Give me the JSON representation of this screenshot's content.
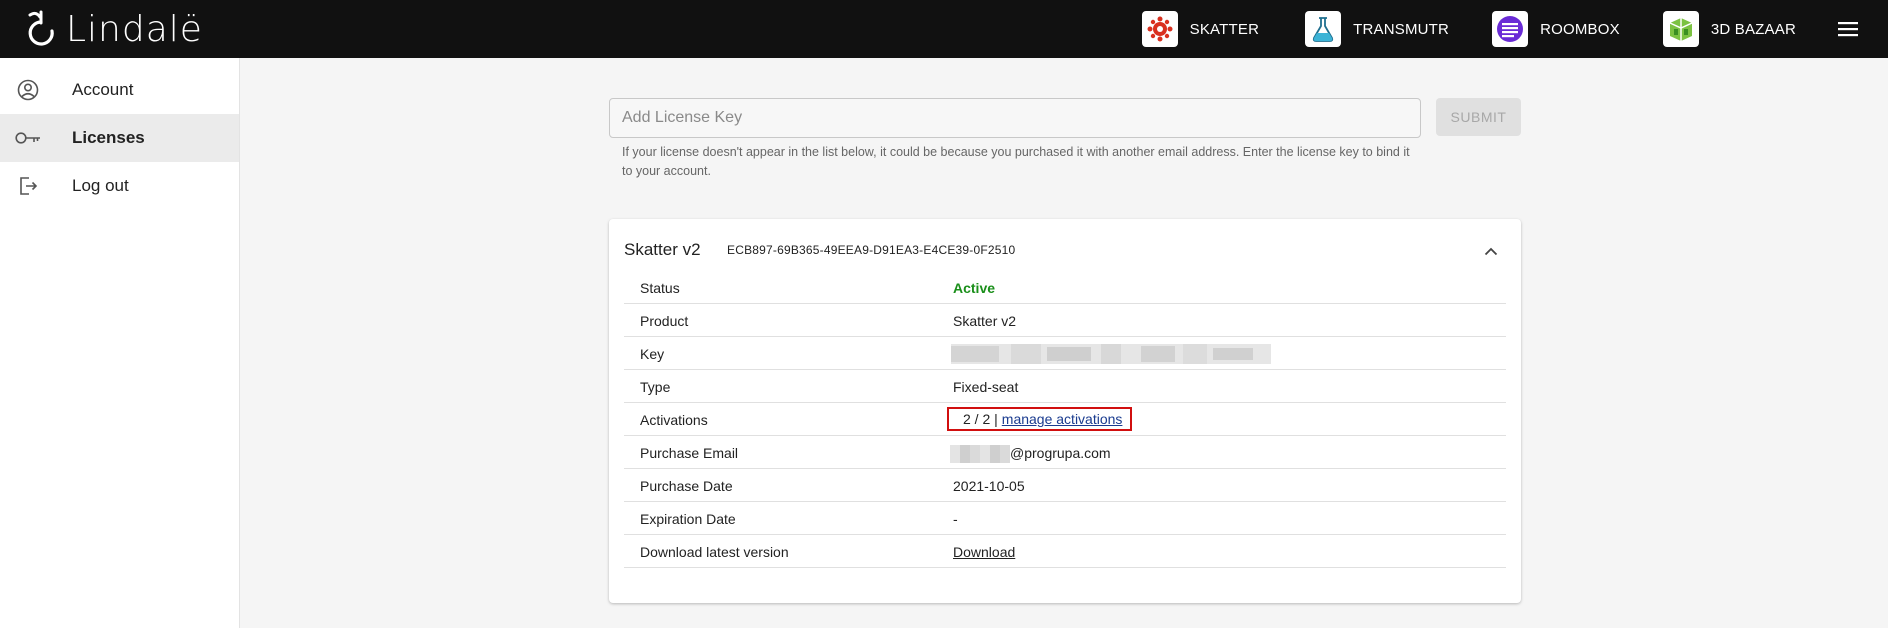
{
  "header": {
    "logo_text": "Lindalë",
    "apps": [
      {
        "label": "SKATTER",
        "icon": "skatter-icon"
      },
      {
        "label": "TRANSMUTR",
        "icon": "transmutr-icon"
      },
      {
        "label": "ROOMBOX",
        "icon": "roombox-icon"
      },
      {
        "label": "3D BAZAAR",
        "icon": "3d-bazaar-icon"
      }
    ],
    "menu_icon": "hamburger-menu-icon"
  },
  "sidebar": {
    "items": [
      {
        "label": "Account",
        "icon": "account-circle-icon",
        "active": false
      },
      {
        "label": "Licenses",
        "icon": "key-icon",
        "active": true
      },
      {
        "label": "Log out",
        "icon": "logout-icon",
        "active": false
      }
    ]
  },
  "license_form": {
    "placeholder": "Add License Key",
    "value": "",
    "submit_label": "SUBMIT",
    "help_text": "If your license doesn't appear in the list below, it could be because you purchased it with another email address. Enter the license key to bind it to your account."
  },
  "license_card": {
    "title": "Skatter v2",
    "key": "ECB897-69B365-49EEA9-D91EA3-E4CE39-0F2510",
    "expanded": true,
    "rows": {
      "status": {
        "label": "Status",
        "value": "Active"
      },
      "product": {
        "label": "Product",
        "value": "Skatter v2"
      },
      "key": {
        "label": "Key"
      },
      "type": {
        "label": "Type",
        "value": "Fixed-seat"
      },
      "activations": {
        "label": "Activations",
        "value": "2 / 2 |",
        "link": "manage activations"
      },
      "purchase_email": {
        "label": "Purchase Email",
        "value": "@progrupa.com"
      },
      "purchase_date": {
        "label": "Purchase Date",
        "value": "2021-10-05"
      },
      "expiration_date": {
        "label": "Expiration Date",
        "value": "-"
      },
      "download": {
        "label": "Download latest version",
        "link": "Download"
      }
    }
  },
  "colors": {
    "topbar": "#111111",
    "active_status": "#1a8f1a",
    "highlight_box": "#d10f0f",
    "link": "#1a3b8f"
  }
}
